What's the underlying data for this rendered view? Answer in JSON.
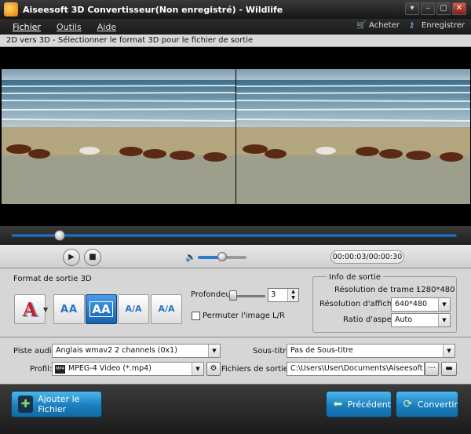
{
  "window": {
    "title": "Aiseesoft 3D Convertisseur(Non enregistré) - Wildlife",
    "buttons": [
      "▾",
      "–",
      "▢",
      "✕"
    ]
  },
  "menu": {
    "items": [
      "Fichier",
      "Outils",
      "Aide"
    ],
    "buy": "Acheter",
    "register": "Enregistrer"
  },
  "step": {
    "text": "2D vers 3D - Sélectionner le format 3D pour le fichier de sortie"
  },
  "playback": {
    "progress_fraction": 0.11,
    "volume_fraction": 0.5,
    "time": "00:00:03/00:00:30",
    "play_icon": "▶",
    "stop_icon": "■",
    "volume_icon": "🔈"
  },
  "format3d": {
    "label": "Format de sortie 3D",
    "options": [
      "A",
      "AA",
      "AA",
      "A/A",
      "A/A"
    ],
    "selected_index": 2
  },
  "depth": {
    "label": "Profondeur:",
    "value": "3",
    "swap_label": "Permuter l'image L/R",
    "swap_checked": false
  },
  "info": {
    "title": "Info de sortie",
    "frame_res_label": "Résolution de trame :",
    "frame_res_value": "1280*480",
    "display_res_label": "Résolution d'affichage :",
    "display_res_value": "640*480",
    "aspect_label": "Ratio d'aspect:",
    "aspect_value": "Auto"
  },
  "audio": {
    "label": "Piste audio:",
    "value": "Anglais wmav2 2 channels (0x1)"
  },
  "subtitle": {
    "label": "Sous-titre:",
    "value": "Pas de Sous-titre"
  },
  "profile": {
    "label": "Profil:",
    "value": "MPEG-4 Video (*.mp4)"
  },
  "output": {
    "label": "Fichiers de sortie:",
    "value": "C:\\Users\\User\\Documents\\Aiseesoft Studio\\Vid",
    "browse": "···"
  },
  "footer": {
    "add_file": "Ajouter le Fichier",
    "previous": "Précédent",
    "convert": "Convertir"
  },
  "colors": {
    "accent": "#1a7fc0",
    "selected_format": "#1861ad",
    "progress": "#1e7ad6"
  }
}
